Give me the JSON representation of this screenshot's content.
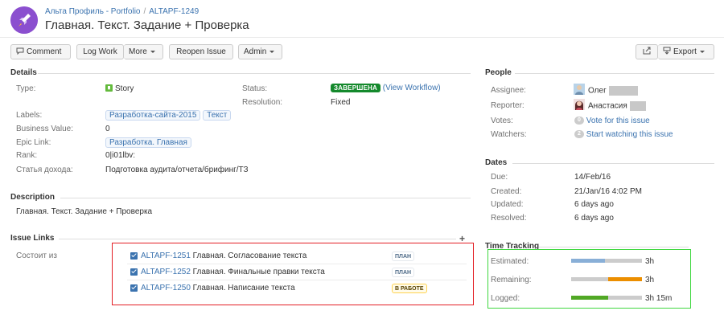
{
  "breadcrumb": {
    "project": "Альта Профиль - Portfolio",
    "separator": "/",
    "issue_key": "ALTAPF-1249"
  },
  "summary": "Главная. Текст. Задание + Проверка",
  "toolbar": {
    "comment": "Comment",
    "log_work": "Log Work",
    "more": "More",
    "reopen": "Reopen Issue",
    "admin": "Admin",
    "export": "Export"
  },
  "details": {
    "header": "Details",
    "type_label": "Type:",
    "type_value": "Story",
    "labels_label": "Labels:",
    "labels": [
      "Разработка-сайта-2015",
      "Текст"
    ],
    "business_value_label": "Business Value:",
    "business_value": "0",
    "epic_label": "Epic Link:",
    "epic_value": "Разработка. Главная",
    "rank_label": "Rank:",
    "rank_value": "0|i01lbv:",
    "income_label": "Статья дохода:",
    "income_value": "Подготовка аудита/отчета/брифинг/ТЗ",
    "status_label": "Status:",
    "status_value": "ЗАВЕРШЕНА",
    "view_workflow": "(View Workflow)",
    "resolution_label": "Resolution:",
    "resolution_value": "Fixed"
  },
  "description": {
    "header": "Description",
    "text": "Главная. Текст. Задание + Проверка"
  },
  "issue_links": {
    "header": "Issue Links",
    "relation": "Состоит из",
    "items": [
      {
        "key": "ALTAPF-1251",
        "summary": "Главная. Согласование текста",
        "status": "ПЛАН"
      },
      {
        "key": "ALTAPF-1252",
        "summary": "Главная. Финальные правки текста",
        "status": "ПЛАН"
      },
      {
        "key": "ALTAPF-1250",
        "summary": "Главная. Написание текста",
        "status": "В РАБОТЕ"
      }
    ]
  },
  "people": {
    "header": "People",
    "assignee_label": "Assignee:",
    "assignee": "Олег",
    "reporter_label": "Reporter:",
    "reporter": "Анастасия",
    "votes_label": "Votes:",
    "votes_count": "0",
    "votes_link": "Vote for this issue",
    "watchers_label": "Watchers:",
    "watchers_count": "2",
    "watchers_link": "Start watching this issue"
  },
  "dates": {
    "header": "Dates",
    "due_label": "Due:",
    "due": "14/Feb/16",
    "created_label": "Created:",
    "created": "21/Jan/16 4:02 PM",
    "updated_label": "Updated:",
    "updated": "6 days ago",
    "resolved_label": "Resolved:",
    "resolved": "6 days ago"
  },
  "time_tracking": {
    "header": "Time Tracking",
    "estimated_label": "Estimated:",
    "estimated": "3h",
    "estimated_fraction": 0.48,
    "remaining_label": "Remaining:",
    "remaining": "3h",
    "remaining_fraction": 0.48,
    "logged_label": "Logged:",
    "logged": "3h 15m",
    "logged_fraction": 0.52
  },
  "colors": {
    "link": "#3b73af",
    "done": "#14892c",
    "estimated_bar": "#89afd7",
    "remaining_bar": "#ec8e00",
    "logged_bar": "#51a825",
    "highlight_red": "#e31e24",
    "highlight_green": "#3fd73f"
  }
}
